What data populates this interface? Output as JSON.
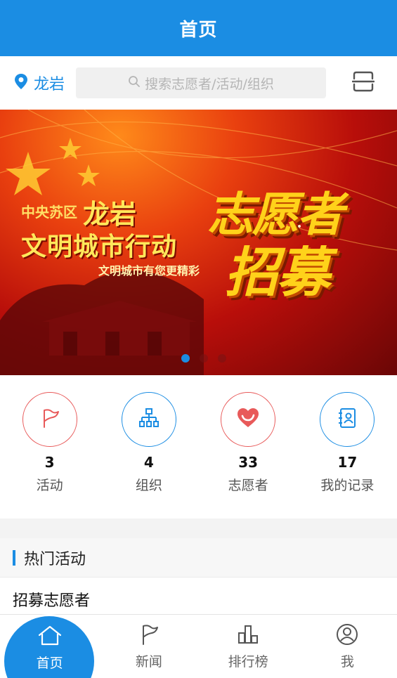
{
  "header": {
    "title": "首页"
  },
  "location": {
    "city": "龙岩"
  },
  "search": {
    "placeholder": "搜索志愿者/活动/组织"
  },
  "banner": {
    "kicker": "中央苏区",
    "kicker_city": "龙岩",
    "headline": "文明城市行动",
    "tagline": "文明城市有您更精彩",
    "big_line1": "志愿者",
    "big_line2": "招募",
    "dots_count": 3,
    "active_dot": 0
  },
  "stats": [
    {
      "count": "3",
      "label": "活动",
      "icon": "flag-icon",
      "color": "#e85a5a"
    },
    {
      "count": "4",
      "label": "组织",
      "icon": "org-chart-icon",
      "color": "#1b8de3"
    },
    {
      "count": "33",
      "label": "志愿者",
      "icon": "heart-icon",
      "color": "#e85a5a"
    },
    {
      "count": "17",
      "label": "我的记录",
      "icon": "record-icon",
      "color": "#1b8de3"
    }
  ],
  "hot": {
    "title": "热门活动",
    "items": [
      {
        "title": "招募志愿者"
      }
    ]
  },
  "tabbar": {
    "items": [
      {
        "label": "首页",
        "icon": "home-icon",
        "active": true
      },
      {
        "label": "新闻",
        "icon": "flag-icon",
        "active": false
      },
      {
        "label": "排行榜",
        "icon": "ranking-icon",
        "active": false
      },
      {
        "label": "我",
        "icon": "profile-icon",
        "active": false
      }
    ]
  },
  "colors": {
    "primary": "#1b8de3",
    "accent_red": "#e85a5a"
  }
}
